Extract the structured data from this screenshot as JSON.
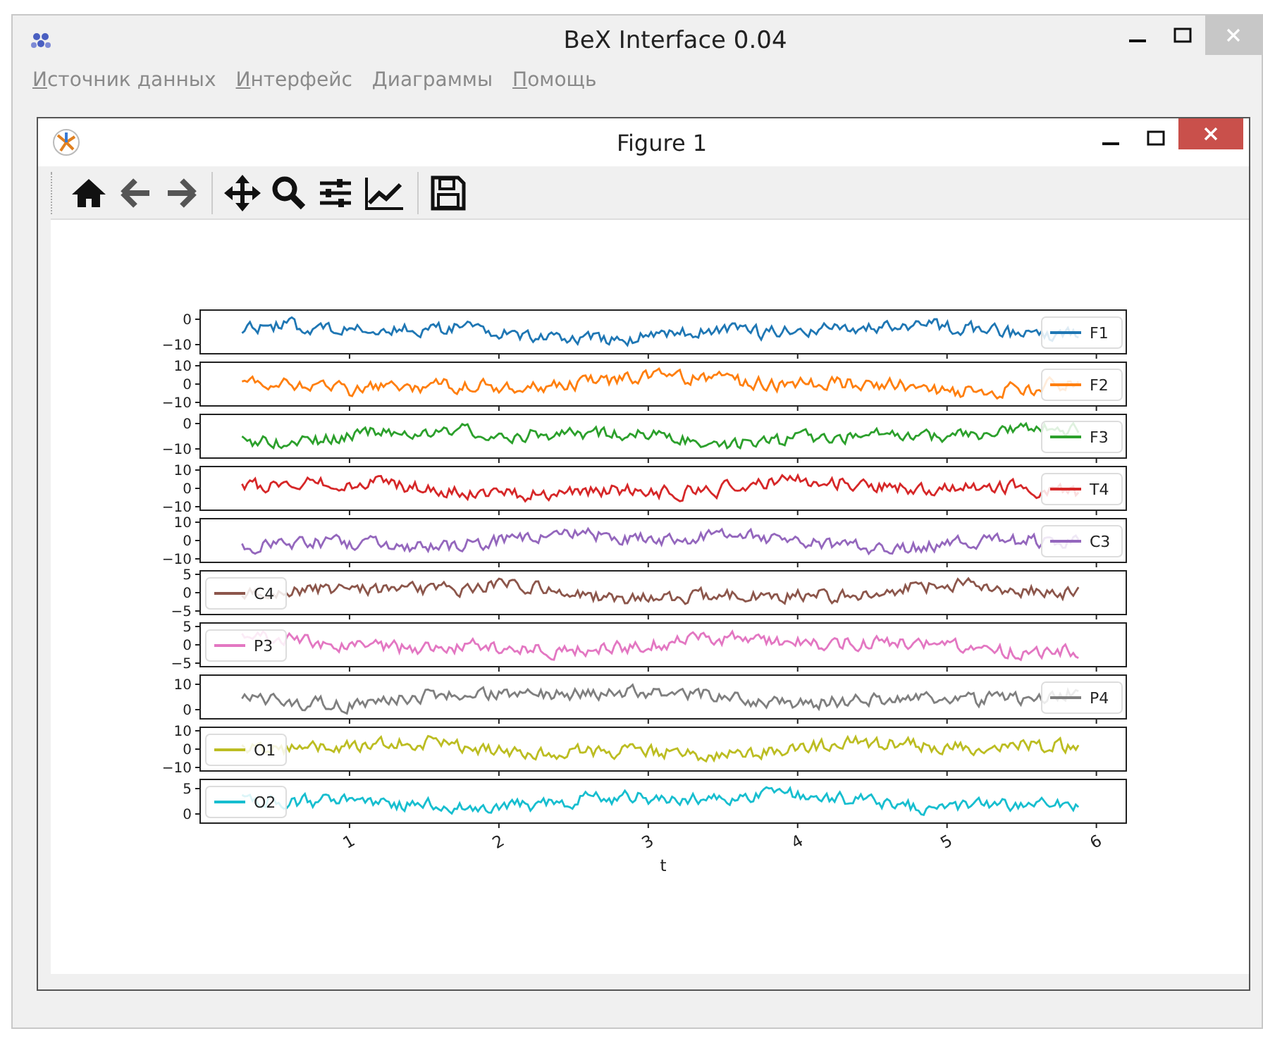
{
  "window": {
    "title": "BeX Interface 0.04"
  },
  "menu": [
    {
      "label": "Источник данных"
    },
    {
      "label": "Интерфейс"
    },
    {
      "label": "Диаграммы"
    },
    {
      "label": "Помощь"
    }
  ],
  "figure": {
    "title": "Figure 1",
    "xlabel": "t",
    "xticks": [
      "1",
      "2",
      "3",
      "4",
      "5",
      "6"
    ],
    "subplots": [
      {
        "label": "F1",
        "color": "#1f77b4",
        "yticks": [
          "0",
          "−10"
        ]
      },
      {
        "label": "F2",
        "color": "#ff7f0e",
        "yticks": [
          "10",
          "0",
          "−10"
        ]
      },
      {
        "label": "F3",
        "color": "#2ca02c",
        "yticks": [
          "0",
          "−10"
        ]
      },
      {
        "label": "T4",
        "color": "#d62728",
        "yticks": [
          "10",
          "0",
          "−10"
        ]
      },
      {
        "label": "C3",
        "color": "#9467bd",
        "yticks": [
          "10",
          "0",
          "−10"
        ]
      },
      {
        "label": "C4",
        "color": "#8c564b",
        "yticks": [
          "5",
          "0",
          "−5"
        ]
      },
      {
        "label": "P3",
        "color": "#e377c2",
        "yticks": [
          "5",
          "0",
          "−5"
        ]
      },
      {
        "label": "P4",
        "color": "#7f7f7f",
        "yticks": [
          "10",
          "0"
        ]
      },
      {
        "label": "O1",
        "color": "#bcbd22",
        "yticks": [
          "10",
          "0",
          "−10"
        ]
      },
      {
        "label": "O2",
        "color": "#17becf",
        "yticks": [
          "5",
          "0"
        ]
      }
    ]
  }
}
